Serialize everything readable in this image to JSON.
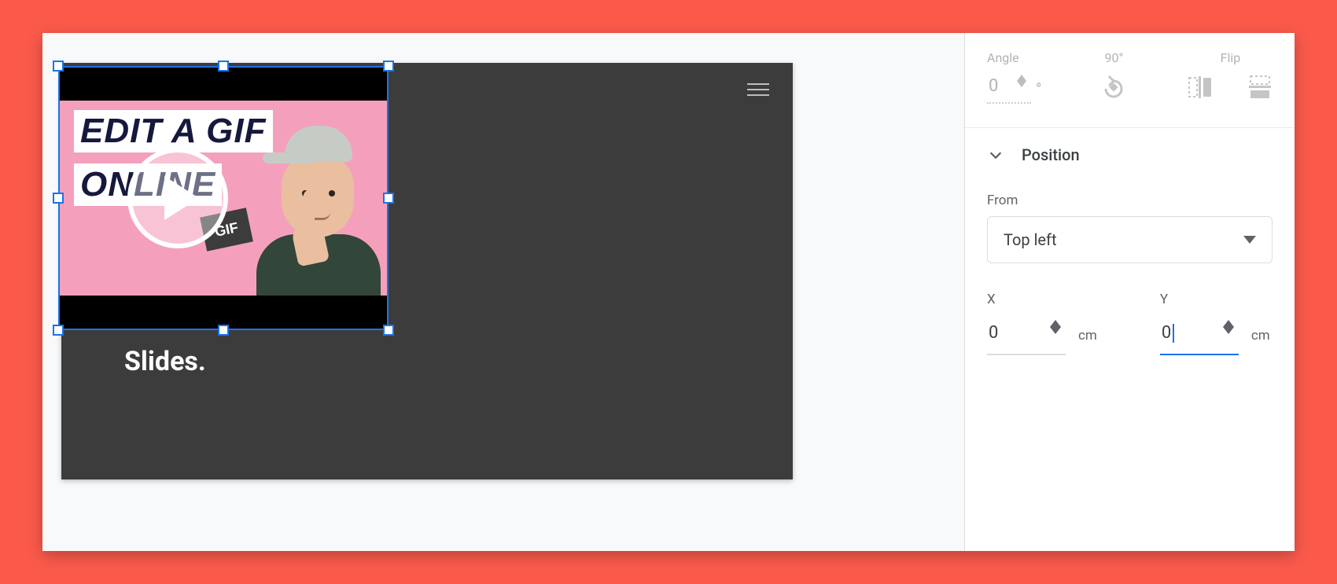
{
  "slide": {
    "visible_text": "Slides."
  },
  "selected_object": {
    "thumbnail_line1": "EDIT A GIF",
    "thumbnail_line2": "ONLINE",
    "gif_badge": "GIF"
  },
  "sidebar": {
    "rotation": {
      "angle_label": "Angle",
      "angle_value": "0",
      "angle_unit": "°",
      "ninety_label": "90°",
      "flip_label": "Flip"
    },
    "position": {
      "section_title": "Position",
      "from_label": "From",
      "from_value": "Top left",
      "x_label": "X",
      "x_value": "0",
      "x_unit": "cm",
      "y_label": "Y",
      "y_value": "0",
      "y_unit": "cm"
    }
  }
}
